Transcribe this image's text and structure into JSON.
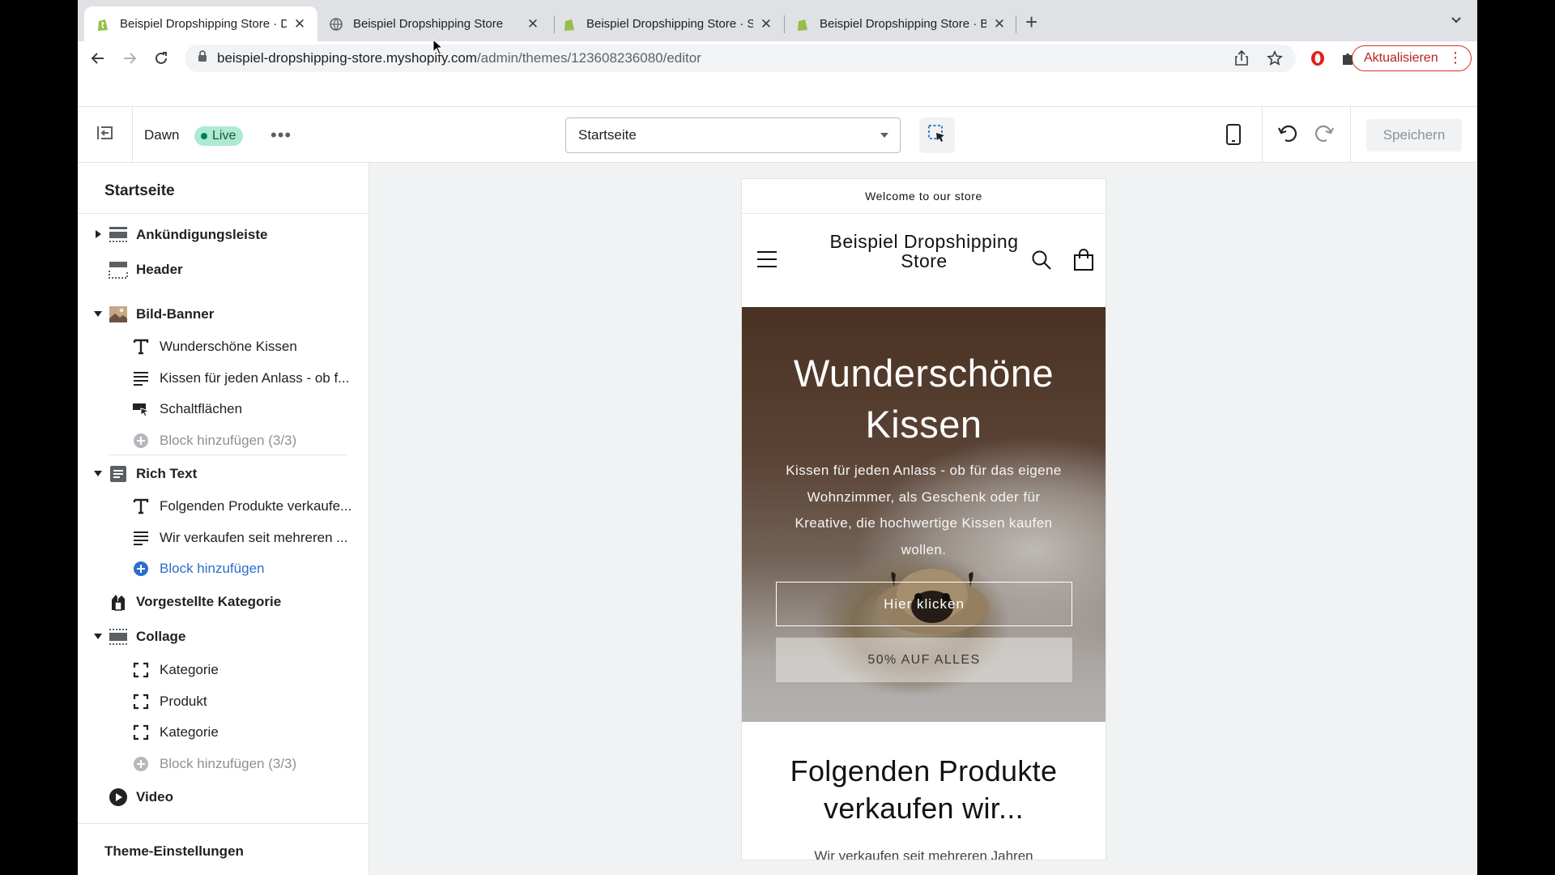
{
  "browser": {
    "tabs": [
      {
        "title": "Beispiel Dropshipping Store · D",
        "favicon": "shopify-icon",
        "active": true
      },
      {
        "title": "Beispiel Dropshipping Store",
        "favicon": "globe-icon",
        "active": false
      },
      {
        "title": "Beispiel Dropshipping Store · S",
        "favicon": "shopify-icon",
        "active": false
      },
      {
        "title": "Beispiel Dropshipping Store · B",
        "favicon": "shopify-icon",
        "active": false
      }
    ],
    "new_tab_label": "+",
    "url_host": "beispiel-dropshipping-store.myshopify.com",
    "url_path": "/admin/themes/123608236080/editor",
    "update_label": "Aktualisieren",
    "colors": {
      "tabstrip": "#dfe1e5",
      "update_accent": "#d93025"
    }
  },
  "editor": {
    "theme_name": "Dawn",
    "live_badge": "Live",
    "more_label": "•••",
    "page_select_value": "Startseite",
    "save_label": "Speichern",
    "colors": {
      "live_badge_bg": "#aee9d1",
      "link_blue": "#2c6ecb"
    }
  },
  "sidebar": {
    "title": "Startseite",
    "sections": {
      "announcement": {
        "label": "Ankündigungsleiste",
        "icon": "section-icon"
      },
      "header": {
        "label": "Header",
        "icon": "header-icon"
      },
      "image_banner": {
        "label": "Bild-Banner",
        "icon": "image-icon"
      },
      "banner_blocks": [
        {
          "label": "Wunderschöne Kissen",
          "icon": "text-heading-icon"
        },
        {
          "label": "Kissen für jeden Anlass - ob f...",
          "icon": "paragraph-icon"
        },
        {
          "label": "Schaltflächen",
          "icon": "button-icon"
        },
        {
          "label": "Block hinzufügen (3/3)",
          "icon": "add-circle-icon"
        }
      ],
      "rich_text": {
        "label": "Rich Text",
        "icon": "rich-text-icon"
      },
      "rich_blocks": [
        {
          "label": "Folgenden Produkte verkaufe...",
          "icon": "text-heading-icon"
        },
        {
          "label": "Wir verkaufen seit mehreren ...",
          "icon": "paragraph-icon"
        },
        {
          "label": "Block hinzufügen",
          "icon": "add-circle-icon"
        }
      ],
      "featured_collection": {
        "label": "Vorgestellte Kategorie",
        "icon": "collection-icon"
      },
      "collage": {
        "label": "Collage",
        "icon": "section-icon"
      },
      "collage_blocks": [
        {
          "label": "Kategorie",
          "icon": "frame-icon"
        },
        {
          "label": "Produkt",
          "icon": "frame-icon"
        },
        {
          "label": "Kategorie",
          "icon": "frame-icon"
        },
        {
          "label": "Block hinzufügen (3/3)",
          "icon": "add-circle-icon"
        }
      ],
      "video": {
        "label": "Video",
        "icon": "play-icon"
      }
    },
    "theme_settings": "Theme-Einstellungen"
  },
  "preview": {
    "announcement": "Welcome to our store",
    "store_name": "Beispiel Dropshipping Store",
    "banner": {
      "heading": "Wunderschöne Kissen",
      "text": "Kissen für jeden Anlass - ob für das eigene Wohnzimmer, als Geschenk oder für Kreative, die hochwertige Kissen kaufen wollen.",
      "button_primary": "Hier klicken",
      "button_secondary": "50% AUF ALLES"
    },
    "rich_text": {
      "heading": "Folgenden Produkte verkaufen wir...",
      "body": "Wir verkaufen seit mehreren Jahren"
    }
  }
}
